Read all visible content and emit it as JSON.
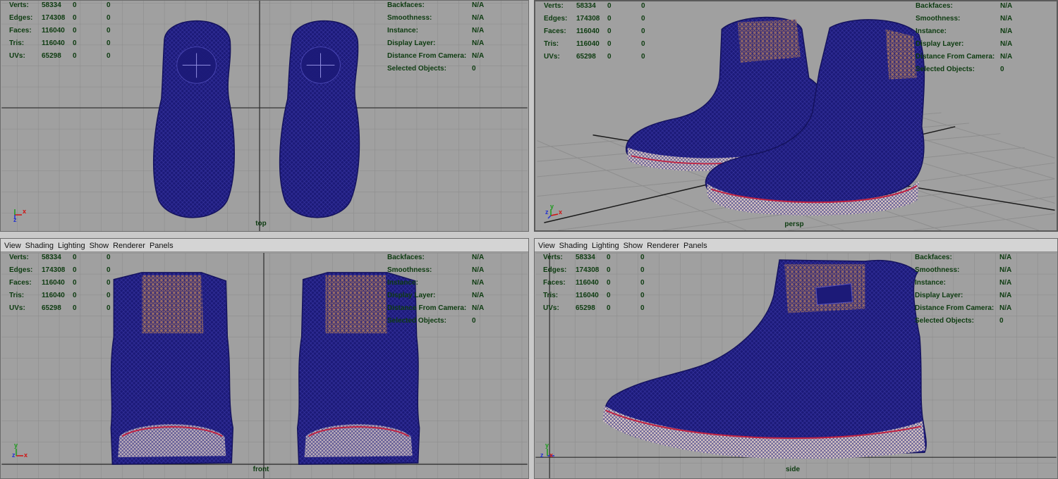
{
  "menu": [
    "View",
    "Shading",
    "Lighting",
    "Show",
    "Renderer",
    "Panels"
  ],
  "hud_left": [
    {
      "label": "Verts:",
      "value": "58334",
      "a": "0",
      "b": "0"
    },
    {
      "label": "Edges:",
      "value": "174308",
      "a": "0",
      "b": "0"
    },
    {
      "label": "Faces:",
      "value": "116040",
      "a": "0",
      "b": "0"
    },
    {
      "label": "Tris:",
      "value": "116040",
      "a": "0",
      "b": "0"
    },
    {
      "label": "UVs:",
      "value": "65298",
      "a": "0",
      "b": "0"
    }
  ],
  "hud_right": [
    {
      "label": "Backfaces:",
      "value": "N/A"
    },
    {
      "label": "Smoothness:",
      "value": "N/A"
    },
    {
      "label": "Instance:",
      "value": "N/A"
    },
    {
      "label": "Display Layer:",
      "value": "N/A"
    },
    {
      "label": "Distance From Camera:",
      "value": "N/A"
    },
    {
      "label": "Selected Objects:",
      "value": "0"
    }
  ],
  "panels": {
    "top": {
      "camera": "top"
    },
    "persp": {
      "camera": "persp"
    },
    "front": {
      "camera": "front"
    },
    "side": {
      "camera": "side"
    }
  },
  "axis_labels": {
    "x": "x",
    "y": "y",
    "z": "z"
  },
  "colors": {
    "viewport_bg": "#a0a0a0",
    "grid": "#8a8a8a",
    "grid_axis": "#2a2a2a",
    "wire": "#1c1a78",
    "wire_light": "#2f2c9a",
    "leather": "#b5806a",
    "sole": "#d8c8c4",
    "sole_stripe": "#c02040",
    "hud_text": "#0d3b10"
  }
}
